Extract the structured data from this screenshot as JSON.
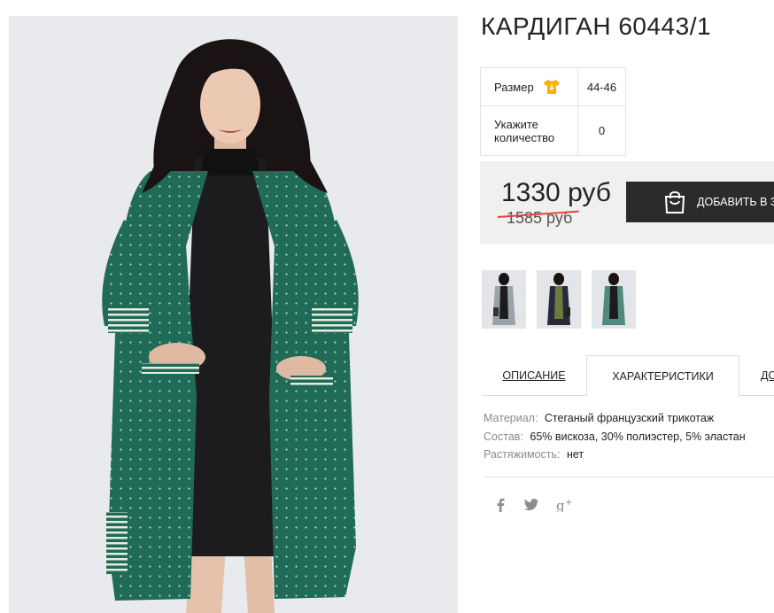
{
  "product": {
    "title": "КАРДИГАН 60443/1"
  },
  "specs": {
    "size_label": "Размер",
    "size_icon": "tshirt-icon",
    "size_value": "44-46",
    "qty_label": "Укажите количество",
    "qty_value": "0"
  },
  "price": {
    "current": "1330 руб",
    "old": "1585 руб",
    "strike_color": "#e8423a"
  },
  "cart": {
    "label": "ДОБАВИТЬ В З",
    "icon": "shopping-bag-icon"
  },
  "thumbnails": [
    {
      "name": "thumbnail-grey-cardigan"
    },
    {
      "name": "thumbnail-navy-cardigan"
    },
    {
      "name": "thumbnail-green-cardigan"
    }
  ],
  "tabs": {
    "description": "ОПИСАНИЕ",
    "characteristics": "ХАРАКТЕРИСТИКИ",
    "more": "ДО"
  },
  "properties": [
    {
      "key": "Материал:",
      "value": "Стеганый французский трикотаж"
    },
    {
      "key": "Состав:",
      "value": "65% вискоза, 30% полиэстер, 5% эластан"
    },
    {
      "key": "Растяжимость:",
      "value": "нет"
    }
  ],
  "social": [
    "facebook-icon",
    "twitter-icon",
    "google-plus-icon"
  ],
  "colors": {
    "accent_dark": "#2b2b2b",
    "price_bg": "#f0f0f0",
    "size_icon": "#f5b400",
    "cardigan": "#1e6b56"
  }
}
